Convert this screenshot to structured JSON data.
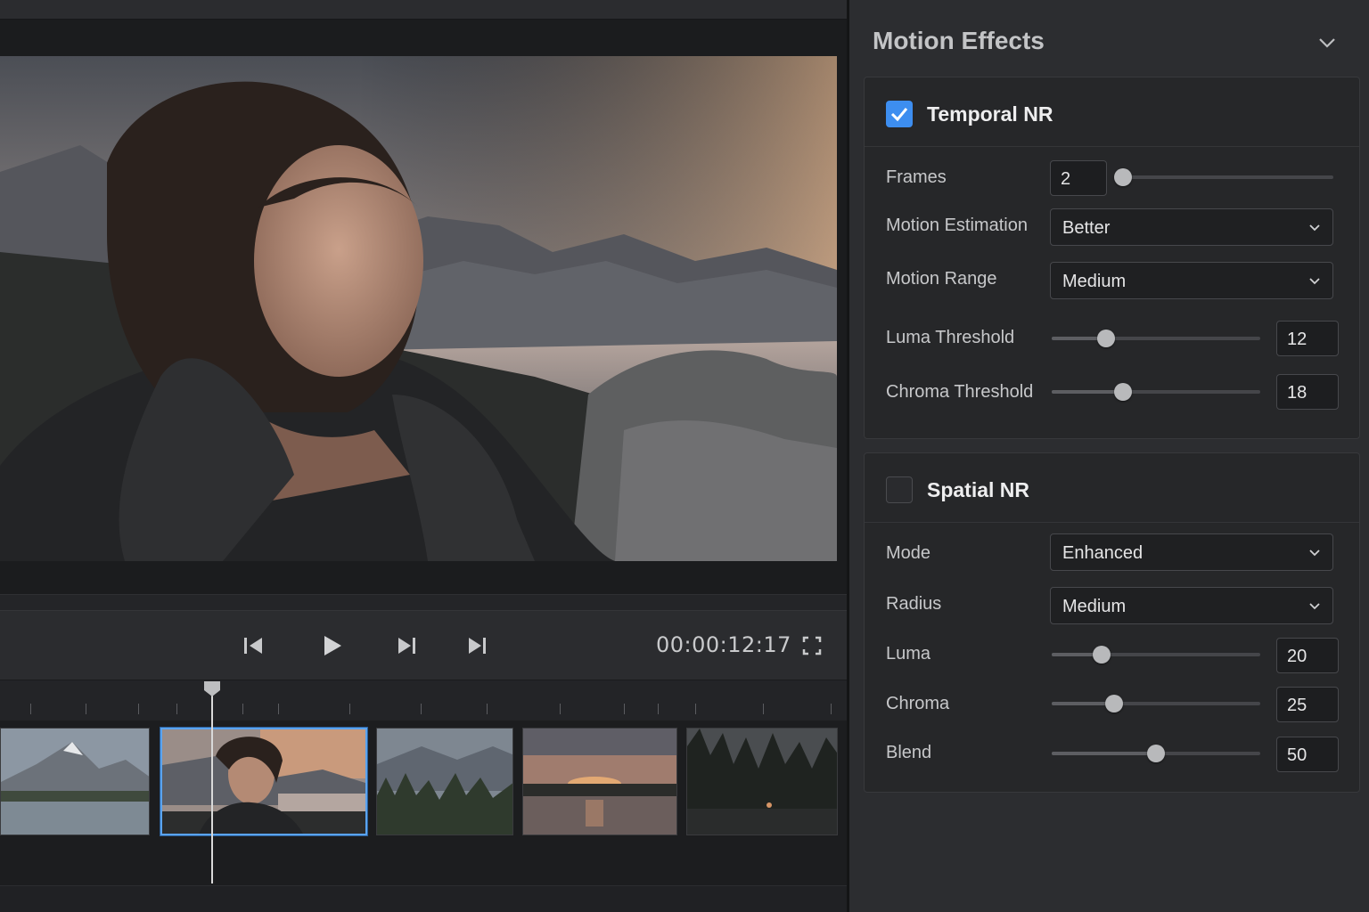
{
  "transport": {
    "timecode": "00:00:12:17",
    "buttons": [
      "skip-to-start",
      "play",
      "step-forward",
      "skip-to-end"
    ]
  },
  "panel": {
    "title": "Motion Effects",
    "temporal_nr": {
      "title": "Temporal NR",
      "enabled": true,
      "frames": {
        "label": "Frames",
        "value": "2",
        "slider_fraction": 0.0
      },
      "motion_estimation": {
        "label": "Motion Estimation",
        "value": "Better"
      },
      "motion_range": {
        "label": "Motion Range",
        "value": "Medium"
      },
      "luma_threshold": {
        "label": "Luma Threshold",
        "value": "12",
        "slider_fraction": 0.26
      },
      "chroma_threshold": {
        "label": "Chroma Threshold",
        "value": "18",
        "slider_fraction": 0.34
      }
    },
    "spatial_nr": {
      "title": "Spatial NR",
      "enabled": false,
      "mode": {
        "label": "Mode",
        "value": "Enhanced"
      },
      "radius": {
        "label": "Radius",
        "value": "Medium"
      },
      "luma": {
        "label": "Luma",
        "value": "20",
        "slider_fraction": 0.24
      },
      "chroma": {
        "label": "Chroma",
        "value": "25",
        "slider_fraction": 0.3
      },
      "blend": {
        "label": "Blend",
        "value": "50",
        "slider_fraction": 0.5
      }
    }
  },
  "colors": {
    "accent": "#3d8ef0",
    "selection": "#5aa3ef"
  }
}
